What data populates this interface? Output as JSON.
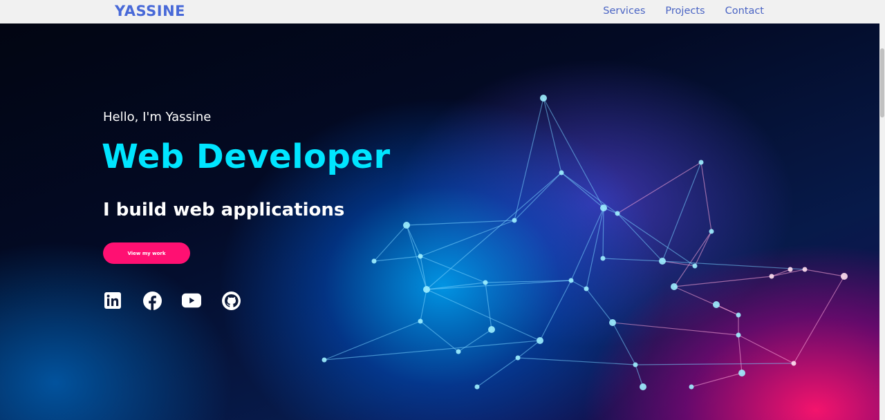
{
  "nav": {
    "brand": "YASSINE",
    "links": [
      "Services",
      "Projects",
      "Contact"
    ]
  },
  "hero": {
    "intro": "Hello, I'm Yassine",
    "headline": "Web Developer",
    "tagline": "I build web applications",
    "cta_label": "View my work",
    "socials": [
      "linkedin-icon",
      "facebook-icon",
      "youtube-icon",
      "github-icon"
    ]
  },
  "colors": {
    "brand": "#4869d8",
    "nav_link": "#4a64c4",
    "headline": "#00e5ff",
    "cta": "#ff1072",
    "nav_bg": "#f1f1f1"
  }
}
